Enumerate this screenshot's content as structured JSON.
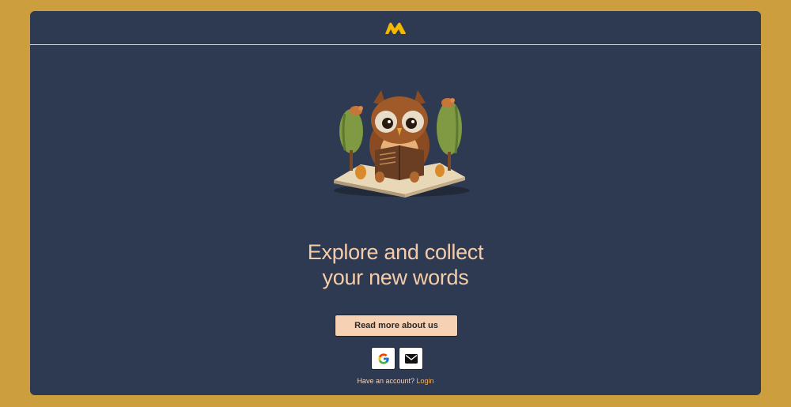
{
  "brand": {
    "logo_icon": "m-logo-icon",
    "logo_color": "#f5b800"
  },
  "hero": {
    "image_icon": "owl-reading-book-illustration"
  },
  "headline": {
    "line1": "Explore and collect",
    "line2": "your new words"
  },
  "actions": {
    "read_more_label": "Read more about us",
    "google_icon": "google-icon",
    "email_icon": "envelope-icon"
  },
  "footer": {
    "prompt": "Have an account?",
    "login_label": "Login"
  },
  "colors": {
    "page_background": "#cd9e3e",
    "card_background": "#2e3a52",
    "headline": "#f4ccaa",
    "button_background": "#f6d1b4",
    "link": "#f0b25e"
  }
}
